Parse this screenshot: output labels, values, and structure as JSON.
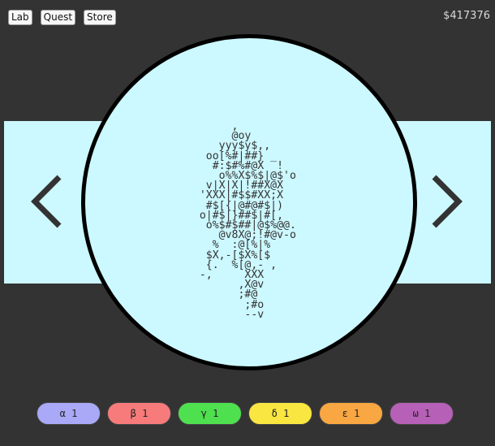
{
  "nav": {
    "lab": "Lab",
    "quest": "Quest",
    "store": "Store"
  },
  "money": "$417376",
  "arrows": {
    "left_icon": "chevron-left-icon",
    "right_icon": "chevron-right-icon"
  },
  "art": "        ,\n        @oy\n      yyy$y$,,\n    oo[%#|##} _\n     #:$#%#@X  !\n      o%%X$%$|@$'o\n    v|X|X|!##X@X\n   'XXX|#$$#XX;X\n    #$[{|@#@#$|)\n   o|#$|}##$|#[,\n    o%$#$##|@$%@@.\n      @v8X@;!#@v-o\n     %  :@[%|%\n    $X,-[$X%[$\n    {.  %[@,- ,\n   -,     XXX\n         ,X@v\n         ;#@\n          ;#o\n          --v",
  "pills": [
    {
      "label": "α 1",
      "color": "#a9a9f7"
    },
    {
      "label": "β 1",
      "color": "#f77b7b"
    },
    {
      "label": "γ 1",
      "color": "#4fe04f"
    },
    {
      "label": "δ 1",
      "color": "#f9e640"
    },
    {
      "label": "ε 1",
      "color": "#f9a742"
    },
    {
      "label": "ω 1",
      "color": "#b760b7"
    }
  ]
}
